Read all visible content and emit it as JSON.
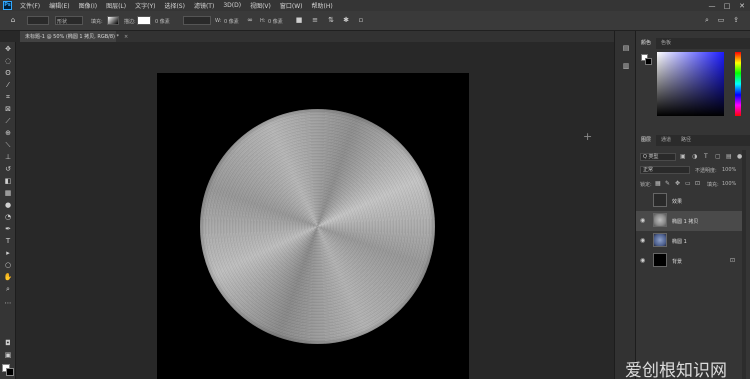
{
  "menubar": {
    "logo": "Ps",
    "items": [
      "文件(F)",
      "编辑(E)",
      "图像(I)",
      "图层(L)",
      "文字(Y)",
      "选择(S)",
      "滤镜(T)",
      "3D(D)",
      "视图(V)",
      "窗口(W)",
      "帮助(H)"
    ],
    "window_controls": [
      "—",
      "□",
      "✕"
    ]
  },
  "options": {
    "shape_mode": "形状",
    "fill_label": "填充:",
    "stroke_label": "描边:",
    "stroke_size": "0 像素",
    "w_label": "W:",
    "w_value": "0 像素",
    "h_label": "H:",
    "h_value": "0 像素"
  },
  "document": {
    "tab_title": "未标题-1 @ 50% (椭圆 1 拷贝, RGB/8) *",
    "tab_close": "×"
  },
  "panels": {
    "color_tabs": [
      "颜色",
      "色板"
    ],
    "layers_tabs": [
      "图层",
      "通道",
      "路径"
    ],
    "filter_kind": "Q 类型",
    "blend_mode": "正常",
    "opacity_label": "不透明度:",
    "opacity_value": "100%",
    "lock_label": "锁定:",
    "fill_label": "填充:",
    "fill_value": "100%",
    "layers": [
      {
        "name": "效果",
        "visible": false,
        "selected": false,
        "thumb": "#2a2a2a"
      },
      {
        "name": "椭圆 1 拷贝",
        "visible": true,
        "selected": true,
        "thumb": "#9c9c9c"
      },
      {
        "name": "椭圆 1",
        "visible": true,
        "selected": false,
        "thumb": "#5a6f9e"
      },
      {
        "name": "背景",
        "visible": true,
        "selected": false,
        "thumb": "#000000",
        "locked": true
      }
    ]
  },
  "colors": {
    "foreground": "#ffffff",
    "background": "#000000",
    "picker_hue": "#1c1cff"
  },
  "watermark": "爱创根知识网"
}
